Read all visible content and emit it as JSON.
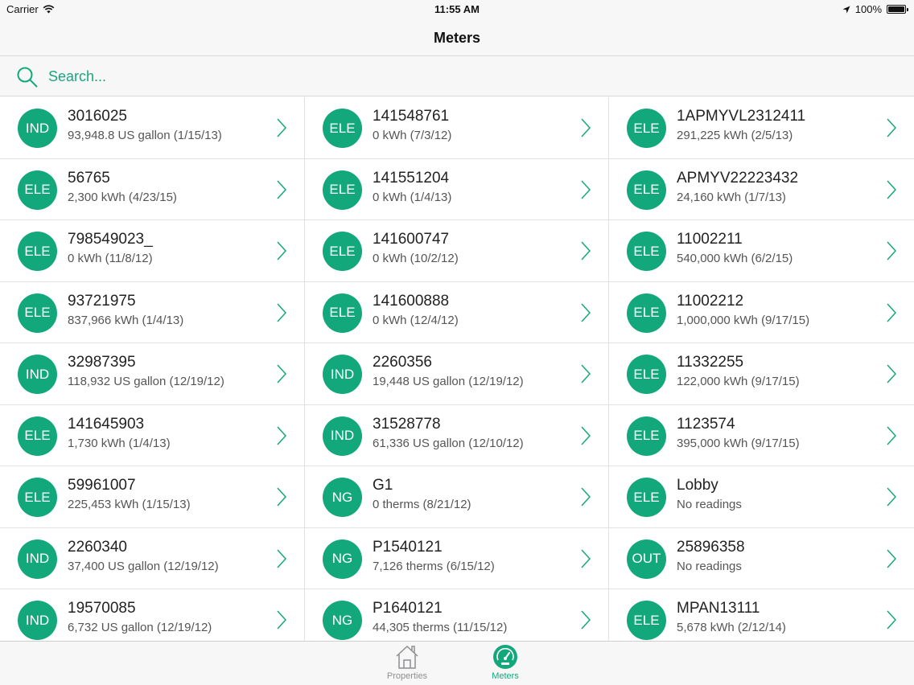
{
  "status": {
    "carrier": "Carrier",
    "time": "11:55 AM",
    "battery": "100%"
  },
  "nav": {
    "title": "Meters"
  },
  "search": {
    "placeholder": "Search..."
  },
  "colors": {
    "accent": "#13a87c",
    "badge": "#13a87c",
    "inactive": "#8e8e93"
  },
  "meters": [
    {
      "type": "IND",
      "id": "3016025",
      "reading": "93,948.8 US gallon (1/15/13)"
    },
    {
      "type": "ELE",
      "id": "141548761",
      "reading": "0 kWh (7/3/12)"
    },
    {
      "type": "ELE",
      "id": "1APMYVL2312411",
      "reading": "291,225 kWh (2/5/13)"
    },
    {
      "type": "ELE",
      "id": "56765",
      "reading": "2,300 kWh (4/23/15)"
    },
    {
      "type": "ELE",
      "id": "141551204",
      "reading": "0 kWh (1/4/13)"
    },
    {
      "type": "ELE",
      "id": "APMYV22223432",
      "reading": "24,160 kWh (1/7/13)"
    },
    {
      "type": "ELE",
      "id": "798549023_",
      "reading": "0 kWh (11/8/12)"
    },
    {
      "type": "ELE",
      "id": "141600747",
      "reading": "0 kWh (10/2/12)"
    },
    {
      "type": "ELE",
      "id": "11002211",
      "reading": "540,000 kWh (6/2/15)"
    },
    {
      "type": "ELE",
      "id": "93721975",
      "reading": "837,966 kWh (1/4/13)"
    },
    {
      "type": "ELE",
      "id": "141600888",
      "reading": "0 kWh (12/4/12)"
    },
    {
      "type": "ELE",
      "id": "11002212",
      "reading": "1,000,000 kWh (9/17/15)"
    },
    {
      "type": "IND",
      "id": "32987395",
      "reading": "118,932 US gallon (12/19/12)"
    },
    {
      "type": "IND",
      "id": "2260356",
      "reading": "19,448 US gallon (12/19/12)"
    },
    {
      "type": "ELE",
      "id": "11332255",
      "reading": "122,000 kWh (9/17/15)"
    },
    {
      "type": "ELE",
      "id": "141645903",
      "reading": "1,730 kWh (1/4/13)"
    },
    {
      "type": "IND",
      "id": "31528778",
      "reading": "61,336 US gallon (12/10/12)"
    },
    {
      "type": "ELE",
      "id": "1123574",
      "reading": "395,000 kWh (9/17/15)"
    },
    {
      "type": "ELE",
      "id": "59961007",
      "reading": "225,453 kWh (1/15/13)"
    },
    {
      "type": "NG",
      "id": "G1",
      "reading": "0 therms (8/21/12)"
    },
    {
      "type": "ELE",
      "id": "Lobby",
      "reading": "No readings"
    },
    {
      "type": "IND",
      "id": "2260340",
      "reading": "37,400 US gallon (12/19/12)"
    },
    {
      "type": "NG",
      "id": "P1540121",
      "reading": "7,126 therms (6/15/12)"
    },
    {
      "type": "OUT",
      "id": "25896358",
      "reading": "No readings"
    },
    {
      "type": "IND",
      "id": "19570085",
      "reading": "6,732 US gallon (12/19/12)"
    },
    {
      "type": "NG",
      "id": "P1640121",
      "reading": "44,305 therms (11/15/12)"
    },
    {
      "type": "ELE",
      "id": "MPAN13111",
      "reading": "5,678 kWh (2/12/14)"
    }
  ],
  "tabs": [
    {
      "label": "Properties",
      "icon": "house-icon",
      "selected": false
    },
    {
      "label": "Meters",
      "icon": "gauge-icon",
      "selected": true
    }
  ]
}
